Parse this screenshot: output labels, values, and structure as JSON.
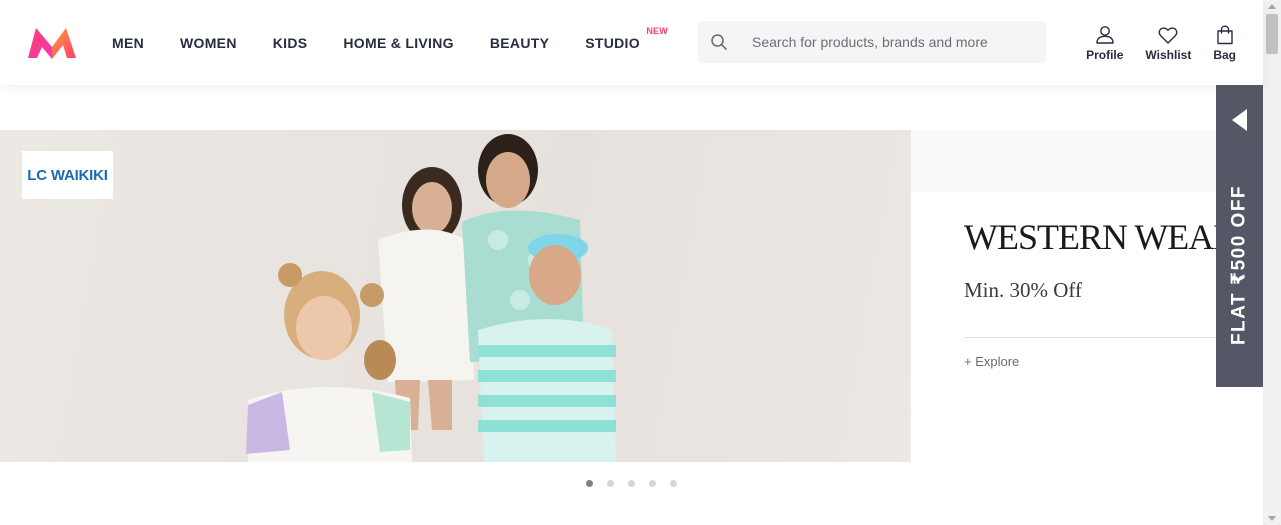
{
  "header": {
    "logo_icon": "myntra-logo-icon",
    "nav": [
      {
        "label": "MEN"
      },
      {
        "label": "WOMEN"
      },
      {
        "label": "KIDS"
      },
      {
        "label": "HOME & LIVING"
      },
      {
        "label": "BEAUTY"
      },
      {
        "label": "STUDIO",
        "badge": "NEW"
      }
    ],
    "search": {
      "icon": "search-icon",
      "placeholder": "Search for products, brands and more",
      "value": ""
    },
    "actions": [
      {
        "label": "Profile",
        "icon": "profile-icon"
      },
      {
        "label": "Wishlist",
        "icon": "heart-icon"
      },
      {
        "label": "Bag",
        "icon": "bag-icon"
      }
    ]
  },
  "banner": {
    "brand": "LC WAIKIKI",
    "title": "WESTERN WEAR",
    "subtitle": "Min. 30% Off",
    "link": "+ Explore",
    "slides_total": 5,
    "active_slide": 1
  },
  "flyout": {
    "text": "FLAT ₹500 OFF",
    "icon": "collapse-arrow-icon"
  },
  "colors": {
    "accent": "#ff3f6c",
    "text": "#282c3f",
    "flyout_bg": "#535766",
    "brand_blue": "#1a6bb3"
  }
}
